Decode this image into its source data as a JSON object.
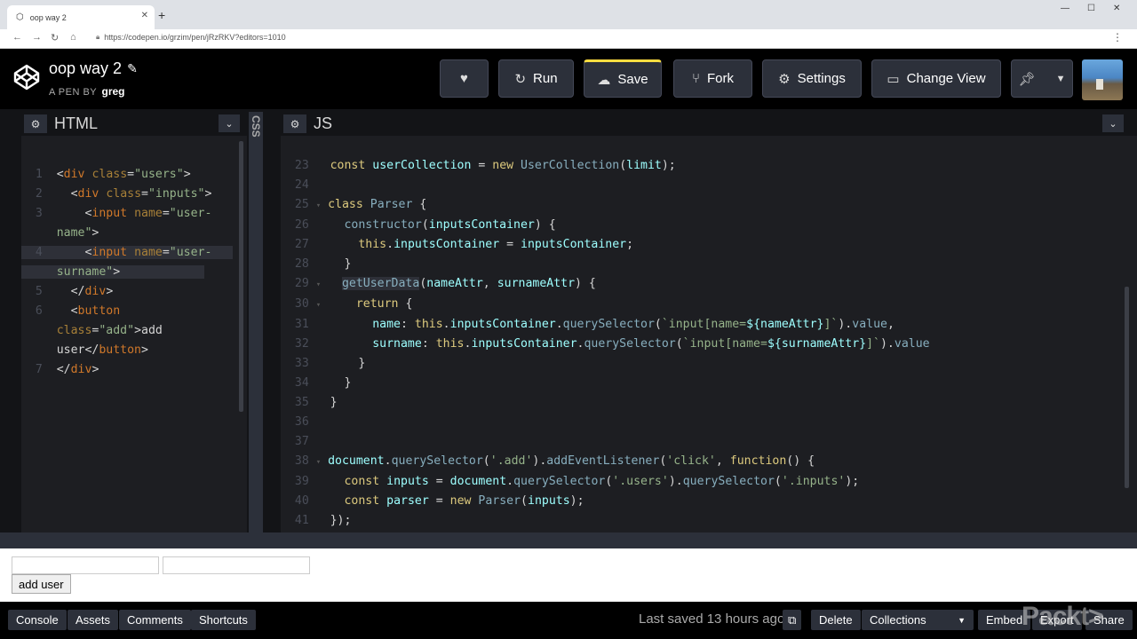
{
  "browser": {
    "tab_title": "oop way 2",
    "url": "https://codepen.io/grzim/pen/jRzRKV?editors=1010"
  },
  "header": {
    "pen_title": "oop way 2",
    "pen_by_prefix": "A PEN BY",
    "author": "greg",
    "buttons": {
      "run": "Run",
      "save": "Save",
      "fork": "Fork",
      "settings": "Settings",
      "change_view": "Change View"
    }
  },
  "html_panel": {
    "title": "HTML",
    "line_numbers": [
      "1",
      "2",
      "3",
      "",
      "4",
      "",
      "5",
      "6",
      "",
      "",
      "7"
    ]
  },
  "css_panel": {
    "title": "CSS"
  },
  "js_panel": {
    "title": "JS",
    "line_numbers": [
      "23",
      "24",
      "25",
      "26",
      "27",
      "28",
      "29",
      "30",
      "31",
      "32",
      "33",
      "34",
      "35",
      "36",
      "37",
      "38",
      "39",
      "40",
      "41"
    ]
  },
  "preview": {
    "button_label": "add user"
  },
  "footer": {
    "console": "Console",
    "assets": "Assets",
    "comments": "Comments",
    "shortcuts": "Shortcuts",
    "last_saved": "Last saved 13 hours ago",
    "delete": "Delete",
    "collections": "Collections",
    "embed": "Embed",
    "export": "Export",
    "share": "Share"
  },
  "watermark": "Packt>",
  "colors": {
    "save_accent": "#ffdd40",
    "editor_bg": "#1d1e22",
    "keyword": "#ddca7e",
    "variable": "#9effff",
    "string": "#96b38a",
    "tag": "#d0782a"
  }
}
